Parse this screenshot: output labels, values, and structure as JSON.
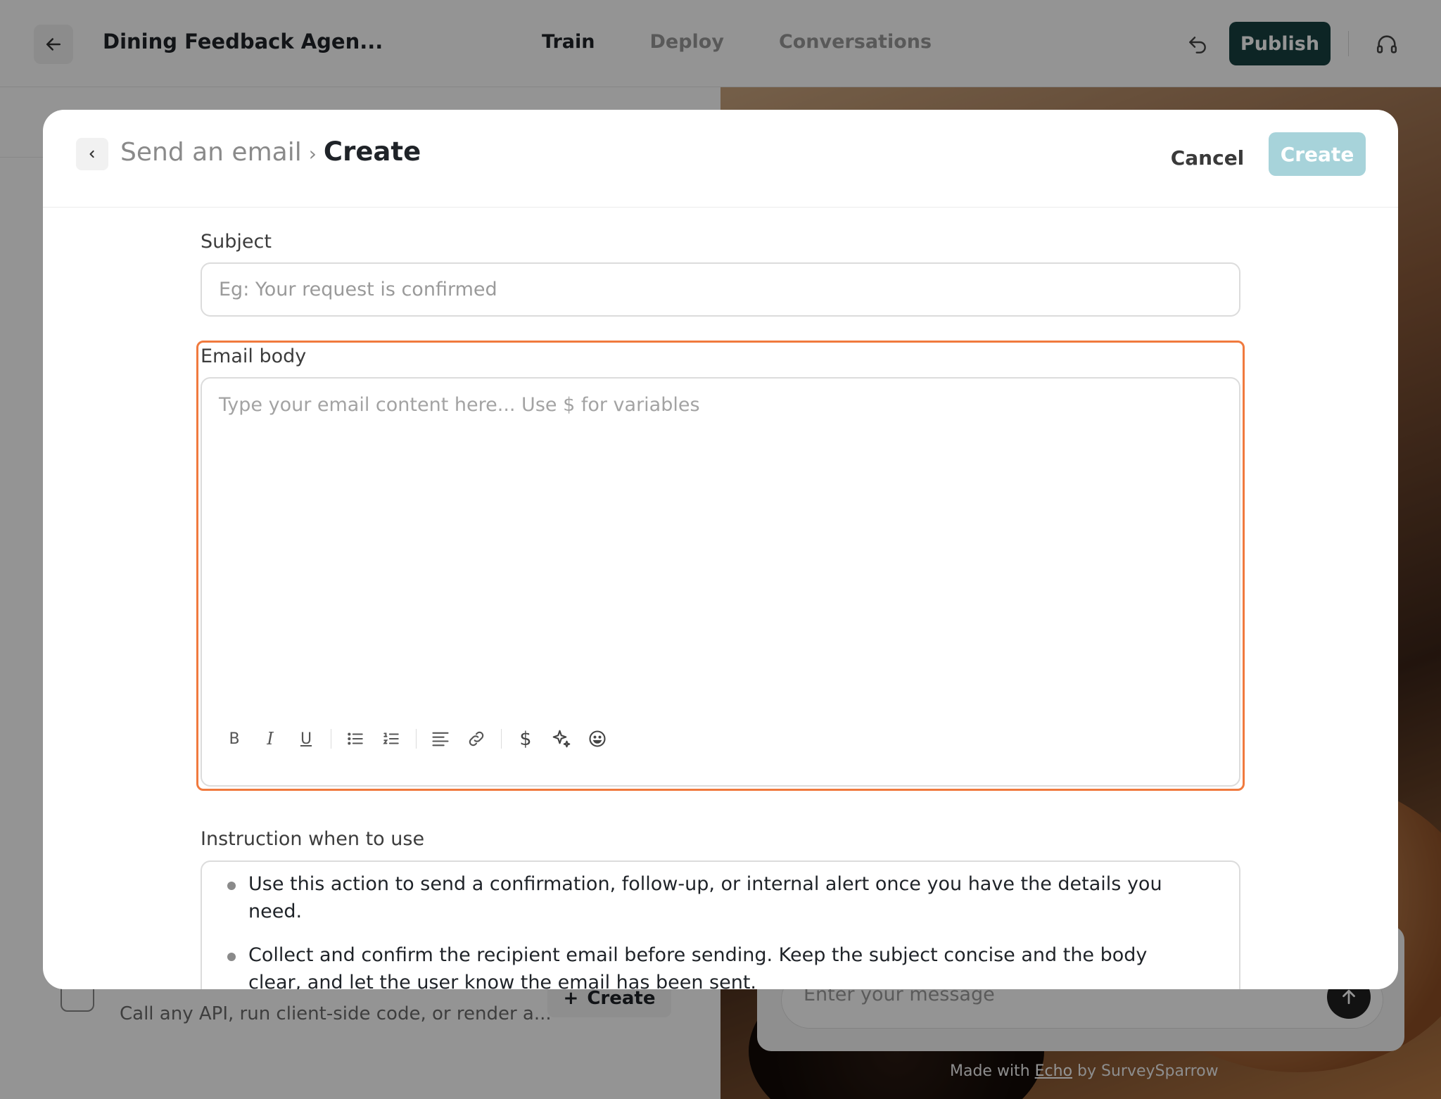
{
  "app": {
    "agent_title": "Dining Feedback Agen...",
    "nav": [
      {
        "label": "Train",
        "active": true
      },
      {
        "label": "Deploy",
        "active": false
      },
      {
        "label": "Conversations",
        "active": false
      }
    ],
    "publish_label": "Publish",
    "publish_color": "#174040"
  },
  "background": {
    "card_description": "Call any API, run client-side code, or render a...",
    "card_create_label": "Create",
    "chat_placeholder": "Enter your message",
    "made_with_prefix": "Made with",
    "made_with_link": "Echo",
    "made_with_suffix": "by SurveySparrow"
  },
  "modal": {
    "breadcrumb_parent": "Send an email",
    "breadcrumb_separator": "›",
    "breadcrumb_current": "Create",
    "cancel_label": "Cancel",
    "create_label": "Create",
    "create_color": "#a7d3da",
    "subject": {
      "label": "Subject",
      "placeholder": "Eg: Your request is confirmed",
      "value": ""
    },
    "email_body": {
      "label": "Email body",
      "placeholder": "Type your email content here... Use $ for variables",
      "focused": true,
      "focus_color": "#f07a3e",
      "toolbar": [
        "bold-icon",
        "italic-icon",
        "underline-icon",
        "bullet-list-icon",
        "numbered-list-icon",
        "align-left-icon",
        "link-icon",
        "variable-dollar-icon",
        "ai-sparkle-icon",
        "emoji-icon"
      ]
    },
    "instruction": {
      "label": "Instruction when to use",
      "items": [
        "Use this action to send a confirmation, follow-up, or internal alert once you have the details you need.",
        "Collect and confirm the recipient email before sending. Keep the subject concise and the body clear, and let the user know the email has been sent."
      ]
    }
  }
}
